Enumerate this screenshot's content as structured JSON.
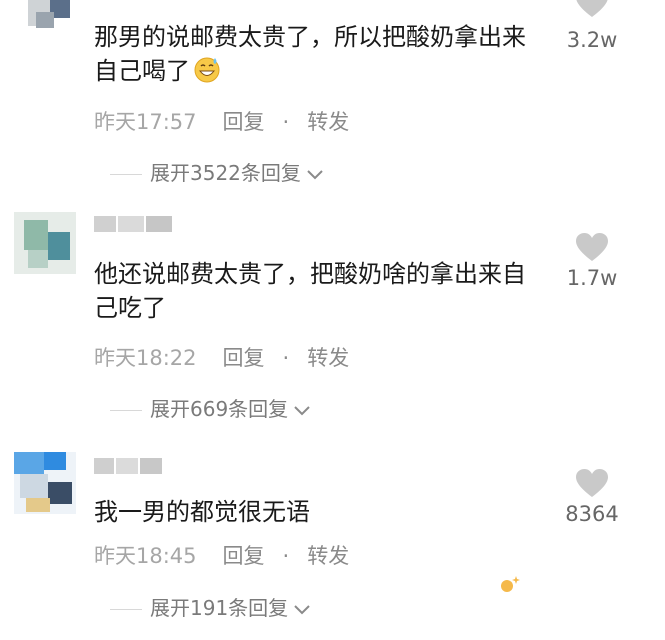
{
  "comments": [
    {
      "text": "那男的说邮费太贵了，所以把酸奶拿出来自己喝了",
      "emoji": "grinning-sweat-emoji",
      "time": "昨天17:57",
      "reply_label": "回复",
      "separator": "·",
      "forward_label": "转发",
      "expand_label": "展开3522条回复",
      "likes": "3.2w"
    },
    {
      "text": "他还说邮费太贵了，把酸奶啥的拿出来自己吃了",
      "time": "昨天18:22",
      "reply_label": "回复",
      "separator": "·",
      "forward_label": "转发",
      "expand_label": "展开669条回复",
      "likes": "1.7w"
    },
    {
      "text": "我一男的都觉很无语",
      "time": "昨天18:45",
      "reply_label": "回复",
      "separator": "·",
      "forward_label": "转发",
      "expand_label": "展开191条回复",
      "likes": "8364"
    }
  ],
  "colors": {
    "heart": "#c9c9c9",
    "meta_text": "#a6a6a6",
    "body_text": "#1a1a1a"
  }
}
